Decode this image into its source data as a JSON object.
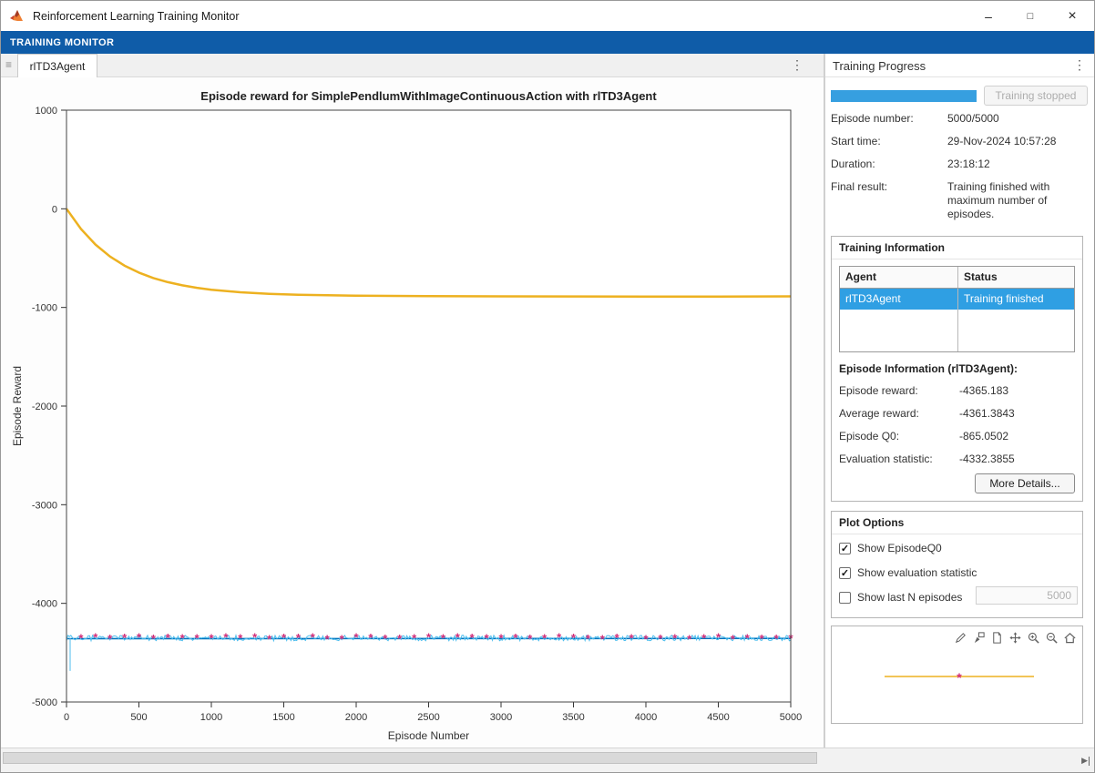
{
  "window": {
    "title": "Reinforcement Learning Training Monitor",
    "controls": {
      "minimize": "–",
      "maximize": "□",
      "close": "×"
    }
  },
  "icons": {
    "kebab": "⋮",
    "grip": "≡",
    "expander": "▶"
  },
  "ribbon": {
    "tab_label": "TRAINING MONITOR"
  },
  "doc_tab": {
    "label": "rlTD3Agent"
  },
  "progress_panel": {
    "title": "Training Progress",
    "progress_percent": 100,
    "stop_button_label": "Training stopped",
    "fields": [
      {
        "label": "Episode number:",
        "value": "5000/5000"
      },
      {
        "label": "Start time:",
        "value": "29-Nov-2024 10:57:28"
      },
      {
        "label": "Duration:",
        "value": "23:18:12"
      },
      {
        "label": "Final result:",
        "value": "Training finished with maximum number of episodes."
      }
    ]
  },
  "training_information": {
    "title": "Training Information",
    "table": {
      "headers": [
        "Agent",
        "Status"
      ],
      "rows": [
        {
          "agent": "rlTD3Agent",
          "status": "Training finished",
          "selected": true
        }
      ]
    },
    "episode_info_title": "Episode Information (rlTD3Agent):",
    "fields": [
      {
        "label": "Episode reward:",
        "value": "-4365.183"
      },
      {
        "label": "Average reward:",
        "value": "-4361.3843"
      },
      {
        "label": "Episode Q0:",
        "value": "-865.0502"
      },
      {
        "label": "Evaluation statistic:",
        "value": "-4332.3855"
      }
    ],
    "more_details_label": "More Details..."
  },
  "plot_options": {
    "title": "Plot Options",
    "options": [
      {
        "label": "Show EpisodeQ0",
        "checked": true
      },
      {
        "label": "Show evaluation statistic",
        "checked": true
      },
      {
        "label": "Show last N episodes",
        "checked": false
      }
    ],
    "last_n_value": "5000"
  },
  "mini_plot": {
    "toolbar_icons": [
      "brush-icon",
      "datatip-icon",
      "export-icon",
      "pan-icon",
      "zoom-in-icon",
      "zoom-out-icon",
      "home-icon"
    ]
  },
  "colors": {
    "ribbon_blue": "#0f5ca8",
    "progress_blue": "#369fe0",
    "selection_blue": "#2f9fe3"
  },
  "chart_data": {
    "type": "line",
    "title": "Episode reward for SimplePendlumWithImageContinuousAction with rlTD3Agent",
    "xlabel": "Episode Number",
    "ylabel": "Episode Reward",
    "xlim": [
      0,
      5000
    ],
    "ylim": [
      -5000,
      1000
    ],
    "xticks": [
      0,
      500,
      1000,
      1500,
      2000,
      2500,
      3000,
      3500,
      4000,
      4500,
      5000
    ],
    "yticks": [
      1000,
      0,
      -1000,
      -2000,
      -3000,
      -4000,
      -5000
    ],
    "grid": false,
    "legend": "none",
    "series": [
      {
        "name": "Average reward",
        "kind": "line",
        "color": "#0072BD",
        "width": 1.6,
        "x": [
          0,
          5000
        ],
        "y": [
          -4358,
          -4356
        ]
      },
      {
        "name": "Episode reward",
        "kind": "noisy",
        "color": "#4DBEEE",
        "width": 1,
        "base": -4352,
        "noise": 28,
        "spikes": [
          {
            "x": 25,
            "y": -4685
          }
        ]
      },
      {
        "name": "Evaluation statistic",
        "kind": "markers",
        "color": "#d12e79",
        "marker": "*",
        "x_start": 100,
        "x_end": 5000,
        "x_step": 100,
        "y": -4330,
        "jitter": 10
      },
      {
        "name": "EpisodeQ0",
        "kind": "line",
        "color": "#EDB120",
        "width": 2.5,
        "x": [
          0,
          100,
          200,
          300,
          400,
          500,
          600,
          700,
          800,
          900,
          1000,
          1200,
          1400,
          1600,
          1800,
          2000,
          2500,
          3000,
          3500,
          4000,
          4500,
          5000
        ],
        "y": [
          0,
          -205,
          -362,
          -483,
          -576,
          -647,
          -702,
          -744,
          -776,
          -801,
          -820,
          -846,
          -862,
          -871,
          -877,
          -881,
          -886,
          -888,
          -889,
          -890,
          -890,
          -888
        ]
      }
    ]
  }
}
